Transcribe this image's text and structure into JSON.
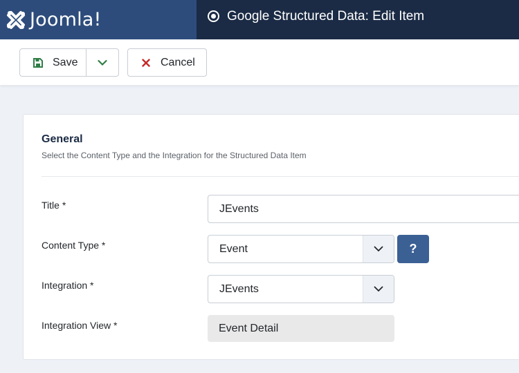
{
  "header": {
    "brand_name": "Joomla!",
    "page_title": "Google Structured Data: Edit Item",
    "brand_color": "#2d4c7c",
    "header_color": "#1b2b45"
  },
  "toolbar": {
    "save_label": "Save",
    "cancel_label": "Cancel",
    "icons": {
      "save": "floppy-disk-icon",
      "dropdown": "chevron-down-icon",
      "cancel": "x-icon"
    },
    "colors": {
      "save_icon": "#2f7d46",
      "dropdown_icon": "#2f7d46",
      "cancel_icon": "#c52827"
    }
  },
  "card": {
    "title": "General",
    "description": "Select the Content Type and the Integration for the Structured Data Item",
    "fields": {
      "title": {
        "label": "Title *",
        "value": "JEvents"
      },
      "content_type": {
        "label": "Content Type *",
        "value": "Event",
        "help_label": "?"
      },
      "integration": {
        "label": "Integration *",
        "value": "JEvents"
      },
      "integration_view": {
        "label": "Integration View *",
        "value": "Event Detail"
      }
    },
    "accent_color": "#3b6094"
  }
}
